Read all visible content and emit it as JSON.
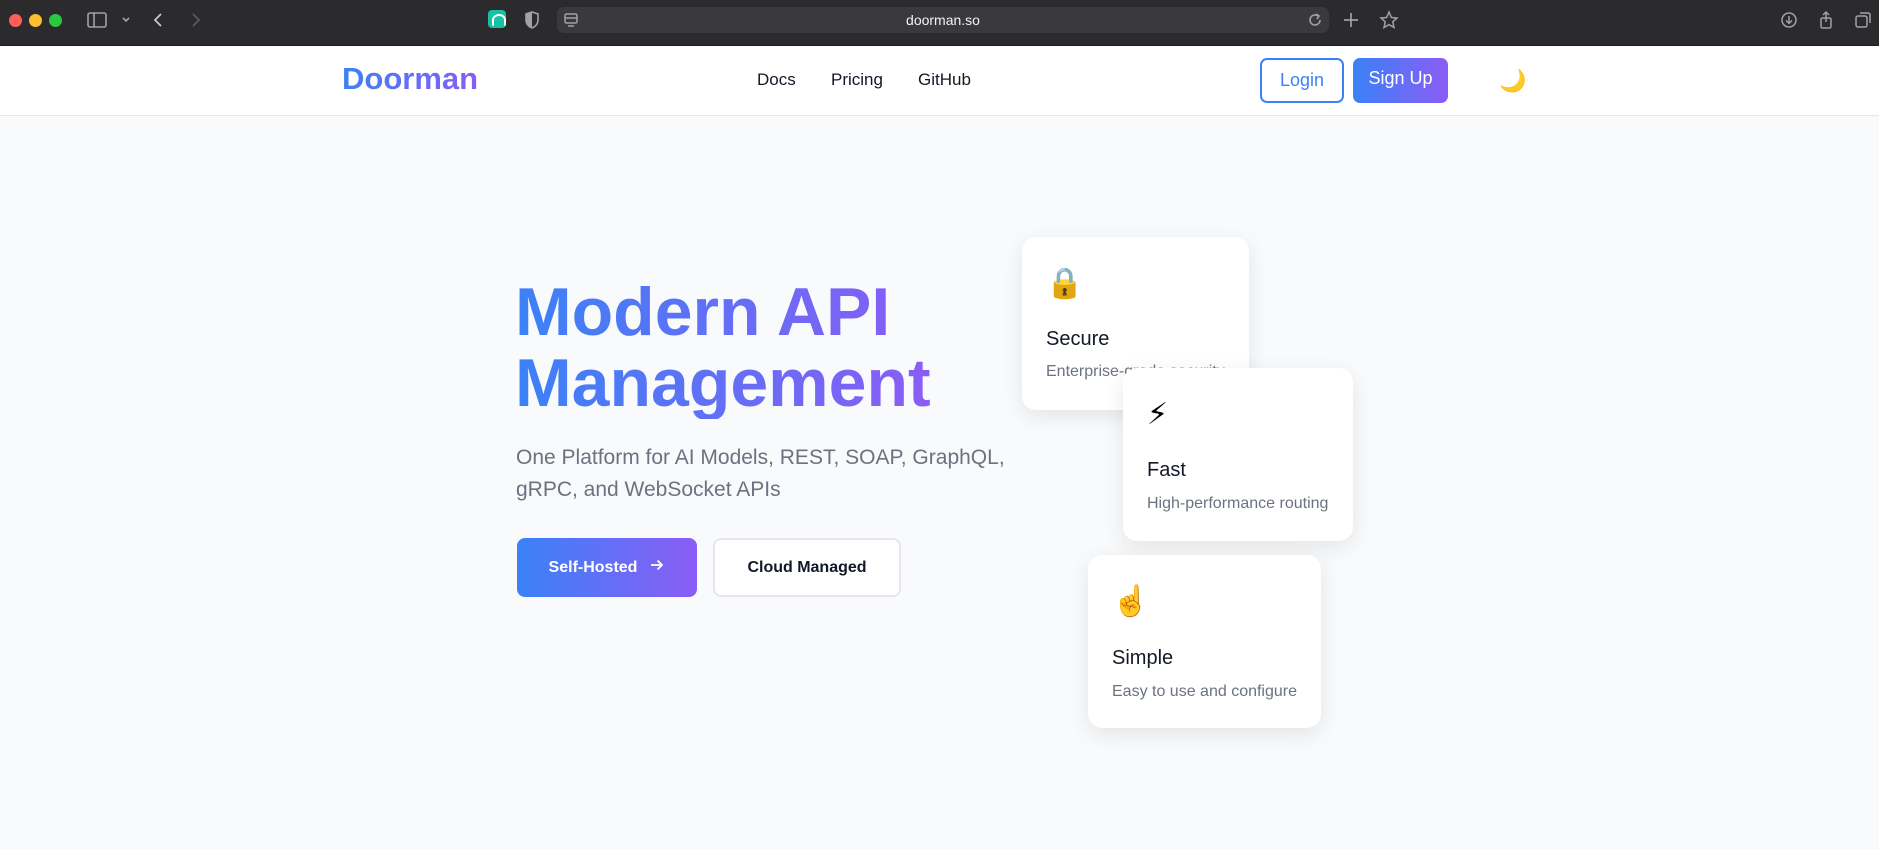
{
  "browser": {
    "url": "doorman.so",
    "icons": [
      "sidebar-icon",
      "chevron-down-icon",
      "back-icon",
      "forward-icon",
      "extension-icon",
      "shield-icon",
      "tab-layout-icon",
      "reload-icon",
      "new-tab-icon",
      "bookmark-star-icon",
      "download-icon",
      "share-icon",
      "tabs-overview-icon"
    ]
  },
  "nav": {
    "brand": "Doorman",
    "links": [
      "Docs",
      "Pricing",
      "GitHub"
    ],
    "login_label": "Login",
    "signup_label": "Sign Up",
    "theme_icon": "moon-icon"
  },
  "hero": {
    "title_line1": "Modern API",
    "title_line2": "Management",
    "subtitle": "One Platform for AI Models, REST, SOAP, GraphQL, gRPC, and WebSocket APIs",
    "primary_label": "Self-Hosted",
    "primary_icon": "arrow-right-icon",
    "secondary_label": "Cloud Managed"
  },
  "features": [
    {
      "icon": "lock-icon",
      "glyph": "🔒",
      "title": "Secure",
      "desc": "Enterprise-grade security"
    },
    {
      "icon": "lightning-icon",
      "glyph": "⚡",
      "title": "Fast",
      "desc": "High-performance routing"
    },
    {
      "icon": "pointing-finger-icon",
      "glyph": "☝️",
      "title": "Simple",
      "desc": "Easy to use and configure"
    }
  ],
  "colors": {
    "accent_start": "#3b82f6",
    "accent_end": "#8b5cf6",
    "page_bg": "#f8fafc"
  }
}
